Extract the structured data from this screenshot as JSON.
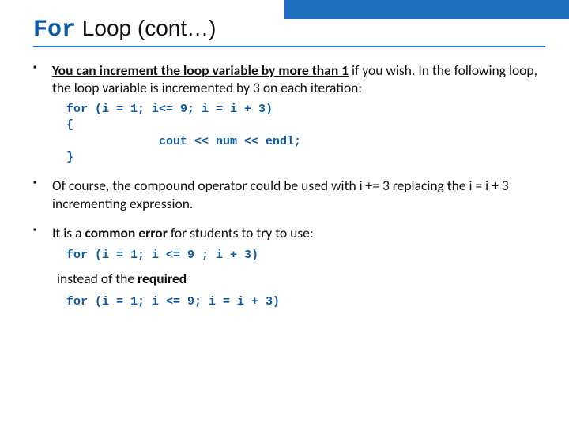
{
  "title": {
    "kw": "For",
    "rest": " Loop (cont…)"
  },
  "bullets": {
    "b1": {
      "prefix_bold": "You can increment the loop variable by more than 1",
      "suffix": " if you wish. In the following loop, the loop variable is incremented by 3 on each iteration:",
      "code": {
        "l1a": "for (i = 1; i<= 9; ",
        "l1b": "i = i + 3)",
        "l2": "{",
        "l3": "             cout << num << endl;",
        "l4": "}"
      }
    },
    "b2": "Of course, the compound operator could be used with i += 3 replacing the i = i + 3 incrementing expression.",
    "b3": {
      "prefix": "It is a ",
      "bold": "common error",
      "suffix": " for students to try to use:",
      "code1": "for (i = 1; i <= 9 ; i + 3)",
      "mid": "instead of the ",
      "mid_bold": "required",
      "code2a": "for (i = 1; i <= 9; ",
      "code2b": "i = i + 3)"
    }
  }
}
